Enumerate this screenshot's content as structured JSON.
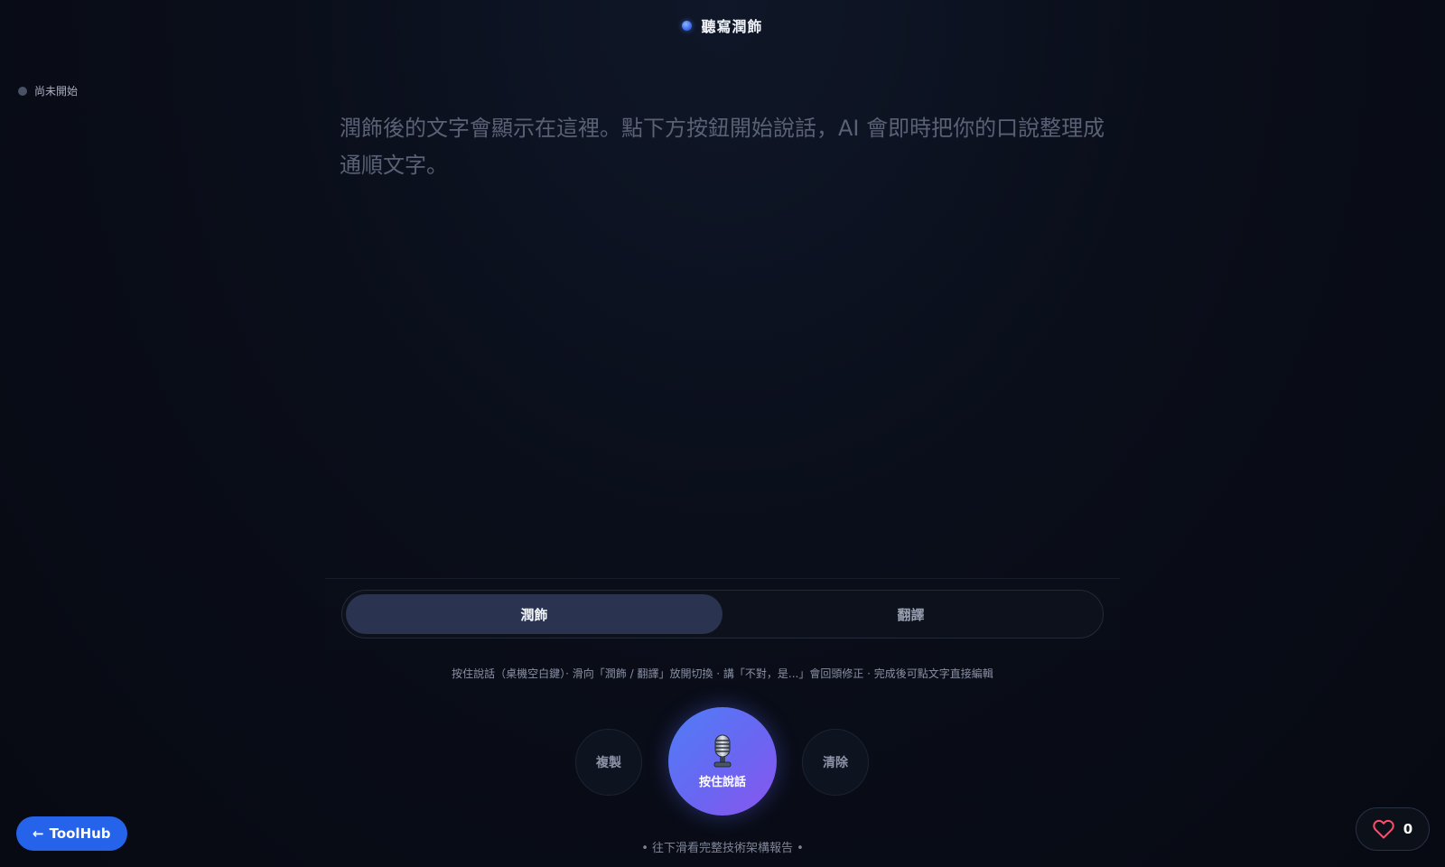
{
  "header": {
    "title": "聽寫潤飾",
    "dot_color": "#4d7ef2"
  },
  "status": {
    "text": "尚未開始",
    "dot_color": "#4a5066"
  },
  "output": {
    "placeholder": "潤飾後的文字會顯示在這裡。點下方按鈕開始說話，AI 會即時把你的口說整理成通順文字。"
  },
  "modes": {
    "tabs": [
      {
        "label": "潤飾",
        "active": true
      },
      {
        "label": "翻譯",
        "active": false
      }
    ]
  },
  "hint": {
    "text": "按住說話（桌機空白鍵）· 滑向「潤飾 / 翻譯」放開切換 · 講「不對，是...」會回頭修正 · 完成後可點文字直接編輯"
  },
  "controls": {
    "copy_label": "複製",
    "mic_label": "按住說話",
    "mic_icon": "microphone-icon",
    "clear_label": "清除"
  },
  "scroll_hint": {
    "text": "• 往下滑看完整技術架構報告 •"
  },
  "toolhub": {
    "label": "ToolHub",
    "icon": "arrow-left-icon",
    "color": "#2563eb"
  },
  "like": {
    "count": "0",
    "icon": "heart-icon",
    "color": "#ff4d6d"
  },
  "colors": {
    "background": "#0a0e1a",
    "accent": "#5b6ff3"
  }
}
